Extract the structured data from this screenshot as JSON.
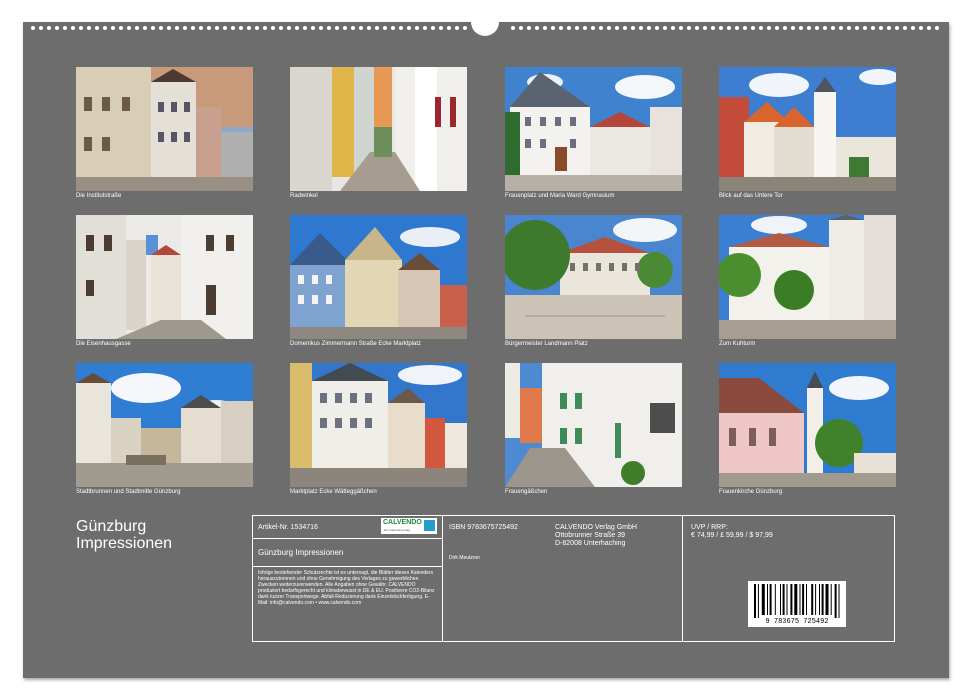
{
  "captions": [
    "Die Institutstraße",
    "Radwinkel",
    "Frauenplatz und Maria Ward Gymnasium",
    "Blick auf das Untere Tor",
    "Die Eisenhausgasse",
    "Domenikus Zimmermann Straße Ecke Marktplatz",
    "Bürgermeister Landmann Platz",
    "Zum Kuhturm",
    "Stadtbrunnen und Stadtmitte Günzburg",
    "Marktplatz Ecke Wätteggäßchen",
    "Frauengäßchen",
    "Frauenkirche Günzburg"
  ],
  "title": {
    "line1": "Günzburg",
    "line2": "Impressionen"
  },
  "info": {
    "article": "Artikel-Nr. 1534716",
    "logo_text": "CALVENDO",
    "logo_sub": "Der Kalenderverlag",
    "calendar_title": "Günzburg Impressionen",
    "legal": "Infolge bestehender Schutzrechte ist es untersagt, die Blätter dieses Kalenders herauszutrennen und ohne Genehmigung des Verlages zu gewerblichen Zwecken weiterzuverwenden. Alle Angaben ohne Gewähr. CALVENDO produziert bedarfsgerecht und klimabewusst in DE & EU. Positivere CO2-Bilanz dank kurzer Transportwege. Abfall-Reduzierung dank Einzelstückfertigung. E-Mail: info@calvendo.com • www.calvendo.com",
    "isbn": "ISBN 9783675725492",
    "author": "Dirk Meutzner",
    "publisher_1": "CALVENDO Verlag GmbH",
    "publisher_2": "Ottobrunner Straße 39",
    "publisher_3": "D-82008 Unterhaching",
    "price_label": "UVP / RRP:",
    "prices": "€ 74,99 / £ 59,99 / $ 97,99",
    "barcode_number": "9 783675 725492"
  }
}
